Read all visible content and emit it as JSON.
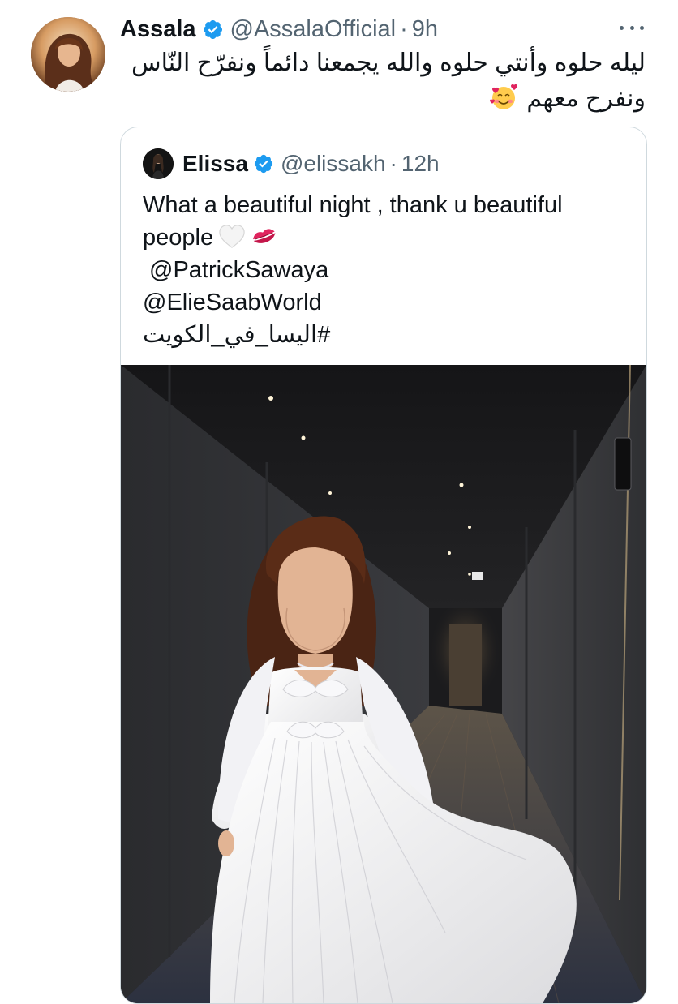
{
  "tweet": {
    "author": {
      "display_name": "Assala",
      "handle": "@AssalaOfficial",
      "separator": "·",
      "time": "9h",
      "avatar_icon": "user-avatar-photo",
      "verified_icon": "verified-badge-icon",
      "verified_color": "#1d9bf0"
    },
    "text_lines": [
      "ليله حلوه وأنتي حلوه والله يجمعنا دائماً ونفرّح النّاس",
      "ونفرح معهم"
    ],
    "text_emoji": "🥰",
    "more_icon": "more-options-icon"
  },
  "quoted_tweet": {
    "author": {
      "display_name": "Elissa",
      "handle": "@elissakh",
      "separator": "·",
      "time": "12h",
      "verified_icon": "verified-badge-icon"
    },
    "text_lines": [
      "What a beautiful night , thank u beautiful",
      "people",
      "@PatrickSawaya",
      "@ElieSaabWorld",
      "#اليسا_في_الكويت"
    ],
    "emojis": [
      "white-heart-emoji",
      "kiss-mark-emoji"
    ],
    "media": {
      "kind": "photo",
      "icon": "photo-woman-white-dress-hallway"
    }
  },
  "colors": {
    "text_primary": "#0f1419",
    "text_secondary": "#536471",
    "border": "#cfd9de"
  }
}
